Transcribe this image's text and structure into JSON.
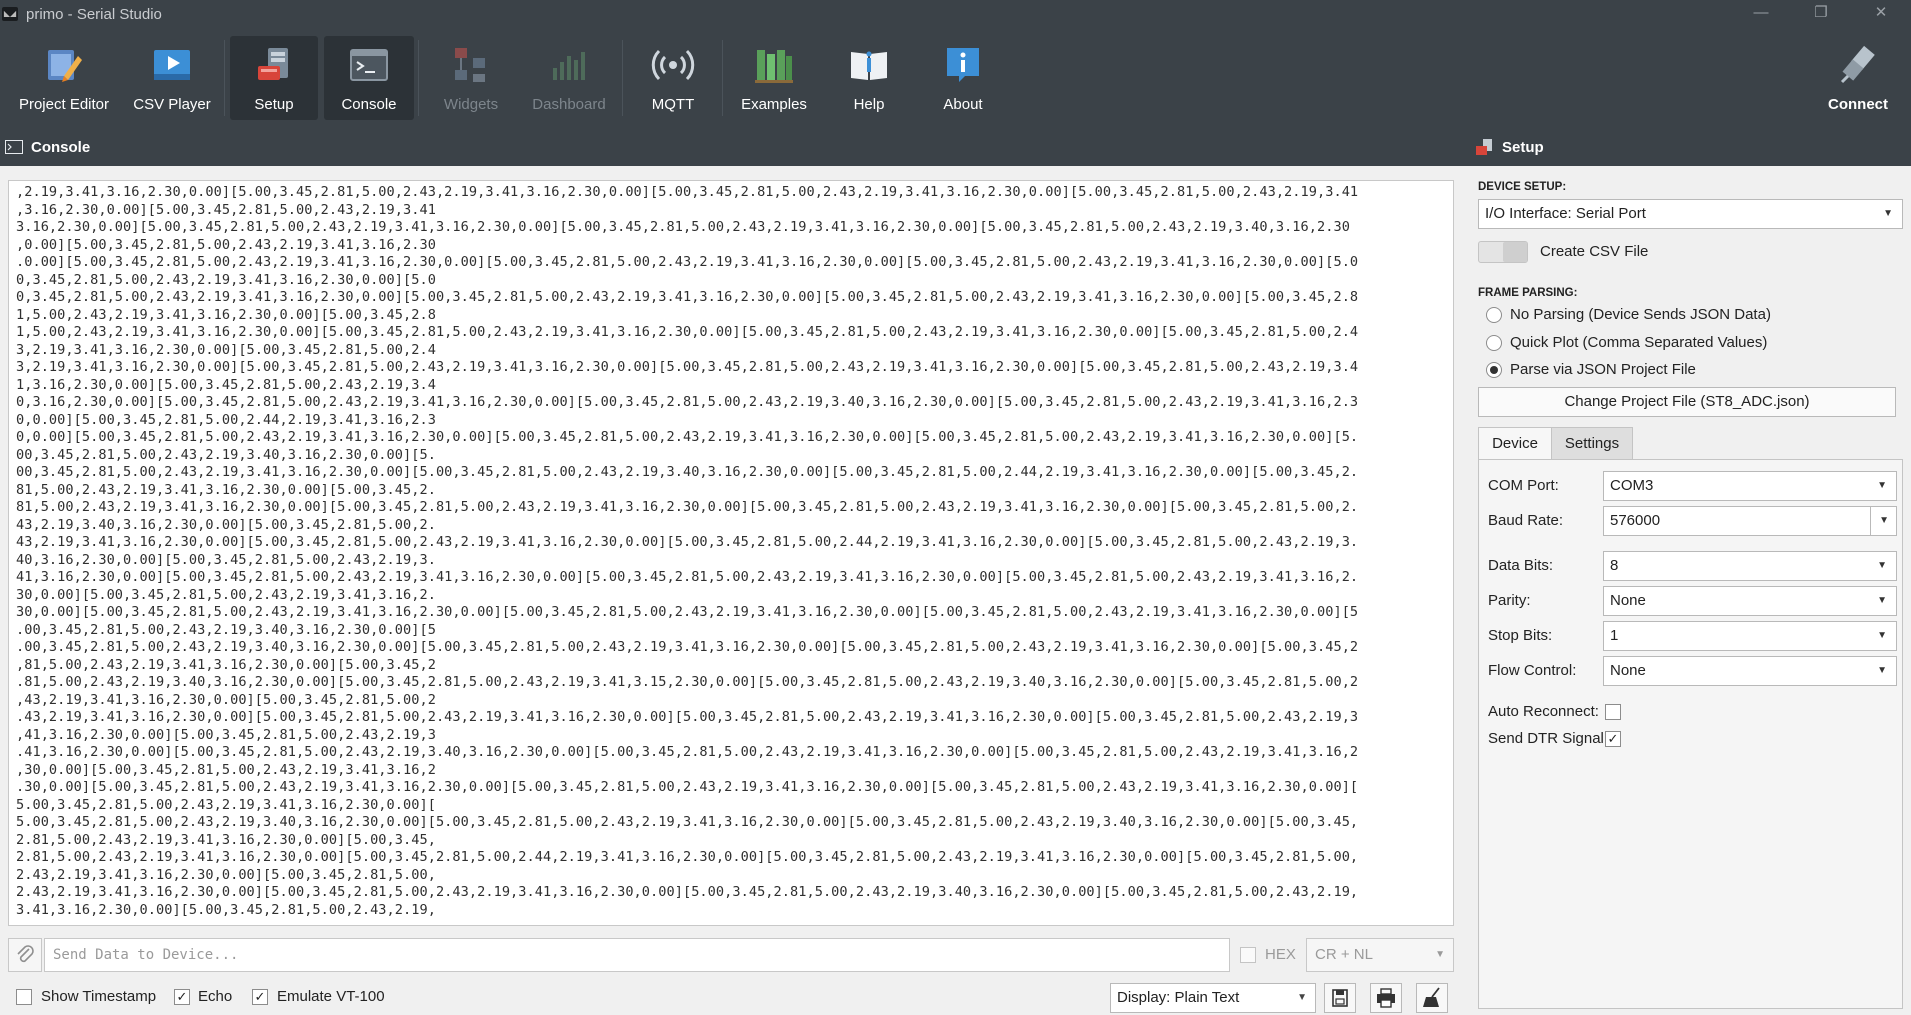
{
  "window": {
    "title": "primo - Serial Studio",
    "controls": [
      "—",
      "❐",
      "✕"
    ]
  },
  "toolbar": {
    "buttons": [
      {
        "label": "Project Editor"
      },
      {
        "label": "CSV Player"
      },
      {
        "label": "Setup"
      },
      {
        "label": "Console"
      },
      {
        "label": "Widgets"
      },
      {
        "label": "Dashboard"
      },
      {
        "label": "MQTT"
      },
      {
        "label": "Examples"
      },
      {
        "label": "Help"
      },
      {
        "label": "About"
      }
    ],
    "connect_label": "Connect"
  },
  "console": {
    "header": "Console",
    "lines": [
      ",2.19,3.41,3.16,2.30,0.00][5.00,3.45,2.81,5.00,2.43,2.19,3.41,3.16,2.30,0.00][5.00,3.45,2.81,5.00,2.43,2.19,3.41,3.16,2.30,0.00][5.00,3.45,2.81,5.00,2.43,2.19,3.41",
      ",3.16,2.30,0.00][5.00,3.45,2.81,5.00,2.43,2.19,3.41",
      "3.16,2.30,0.00][5.00,3.45,2.81,5.00,2.43,2.19,3.41,3.16,2.30,0.00][5.00,3.45,2.81,5.00,2.43,2.19,3.41,3.16,2.30,0.00][5.00,3.45,2.81,5.00,2.43,2.19,3.40,3.16,2.30",
      ",0.00][5.00,3.45,2.81,5.00,2.43,2.19,3.41,3.16,2.30",
      ".0.00][5.00,3.45,2.81,5.00,2.43,2.19,3.41,3.16,2.30,0.00][5.00,3.45,2.81,5.00,2.43,2.19,3.41,3.16,2.30,0.00][5.00,3.45,2.81,5.00,2.43,2.19,3.41,3.16,2.30,0.00][5.0",
      "0,3.45,2.81,5.00,2.43,2.19,3.41,3.16,2.30,0.00][5.0",
      "0,3.45,2.81,5.00,2.43,2.19,3.41,3.16,2.30,0.00][5.00,3.45,2.81,5.00,2.43,2.19,3.41,3.16,2.30,0.00][5.00,3.45,2.81,5.00,2.43,2.19,3.41,3.16,2.30,0.00][5.00,3.45,2.8",
      "1,5.00,2.43,2.19,3.41,3.16,2.30,0.00][5.00,3.45,2.8",
      "1,5.00,2.43,2.19,3.41,3.16,2.30,0.00][5.00,3.45,2.81,5.00,2.43,2.19,3.41,3.16,2.30,0.00][5.00,3.45,2.81,5.00,2.43,2.19,3.41,3.16,2.30,0.00][5.00,3.45,2.81,5.00,2.4",
      "3,2.19,3.41,3.16,2.30,0.00][5.00,3.45,2.81,5.00,2.4",
      "3,2.19,3.41,3.16,2.30,0.00][5.00,3.45,2.81,5.00,2.43,2.19,3.41,3.16,2.30,0.00][5.00,3.45,2.81,5.00,2.43,2.19,3.41,3.16,2.30,0.00][5.00,3.45,2.81,5.00,2.43,2.19,3.4",
      "1,3.16,2.30,0.00][5.00,3.45,2.81,5.00,2.43,2.19,3.4",
      "0,3.16,2.30,0.00][5.00,3.45,2.81,5.00,2.43,2.19,3.41,3.16,2.30,0.00][5.00,3.45,2.81,5.00,2.43,2.19,3.40,3.16,2.30,0.00][5.00,3.45,2.81,5.00,2.43,2.19,3.41,3.16,2.3",
      "0,0.00][5.00,3.45,2.81,5.00,2.44,2.19,3.41,3.16,2.3",
      "0,0.00][5.00,3.45,2.81,5.00,2.43,2.19,3.41,3.16,2.30,0.00][5.00,3.45,2.81,5.00,2.43,2.19,3.41,3.16,2.30,0.00][5.00,3.45,2.81,5.00,2.43,2.19,3.41,3.16,2.30,0.00][5.",
      "00,3.45,2.81,5.00,2.43,2.19,3.40,3.16,2.30,0.00][5.",
      "00,3.45,2.81,5.00,2.43,2.19,3.41,3.16,2.30,0.00][5.00,3.45,2.81,5.00,2.43,2.19,3.40,3.16,2.30,0.00][5.00,3.45,2.81,5.00,2.44,2.19,3.41,3.16,2.30,0.00][5.00,3.45,2.",
      "81,5.00,2.43,2.19,3.41,3.16,2.30,0.00][5.00,3.45,2.",
      "81,5.00,2.43,2.19,3.41,3.16,2.30,0.00][5.00,3.45,2.81,5.00,2.43,2.19,3.41,3.16,2.30,0.00][5.00,3.45,2.81,5.00,2.43,2.19,3.41,3.16,2.30,0.00][5.00,3.45,2.81,5.00,2.",
      "43,2.19,3.40,3.16,2.30,0.00][5.00,3.45,2.81,5.00,2.",
      "43,2.19,3.41,3.16,2.30,0.00][5.00,3.45,2.81,5.00,2.43,2.19,3.41,3.16,2.30,0.00][5.00,3.45,2.81,5.00,2.44,2.19,3.41,3.16,2.30,0.00][5.00,3.45,2.81,5.00,2.43,2.19,3.",
      "40,3.16,2.30,0.00][5.00,3.45,2.81,5.00,2.43,2.19,3.",
      "41,3.16,2.30,0.00][5.00,3.45,2.81,5.00,2.43,2.19,3.41,3.16,2.30,0.00][5.00,3.45,2.81,5.00,2.43,2.19,3.41,3.16,2.30,0.00][5.00,3.45,2.81,5.00,2.43,2.19,3.41,3.16,2.",
      "30,0.00][5.00,3.45,2.81,5.00,2.43,2.19,3.41,3.16,2.",
      "30,0.00][5.00,3.45,2.81,5.00,2.43,2.19,3.41,3.16,2.30,0.00][5.00,3.45,2.81,5.00,2.43,2.19,3.41,3.16,2.30,0.00][5.00,3.45,2.81,5.00,2.43,2.19,3.41,3.16,2.30,0.00][5",
      ".00,3.45,2.81,5.00,2.43,2.19,3.40,3.16,2.30,0.00][5",
      ".00,3.45,2.81,5.00,2.43,2.19,3.40,3.16,2.30,0.00][5.00,3.45,2.81,5.00,2.43,2.19,3.41,3.16,2.30,0.00][5.00,3.45,2.81,5.00,2.43,2.19,3.41,3.16,2.30,0.00][5.00,3.45,2",
      ",81,5.00,2.43,2.19,3.41,3.16,2.30,0.00][5.00,3.45,2",
      ".81,5.00,2.43,2.19,3.40,3.16,2.30,0.00][5.00,3.45,2.81,5.00,2.43,2.19,3.41,3.15,2.30,0.00][5.00,3.45,2.81,5.00,2.43,2.19,3.40,3.16,2.30,0.00][5.00,3.45,2.81,5.00,2",
      ",43,2.19,3.41,3.16,2.30,0.00][5.00,3.45,2.81,5.00,2",
      ".43,2.19,3.41,3.16,2.30,0.00][5.00,3.45,2.81,5.00,2.43,2.19,3.41,3.16,2.30,0.00][5.00,3.45,2.81,5.00,2.43,2.19,3.41,3.16,2.30,0.00][5.00,3.45,2.81,5.00,2.43,2.19,3",
      ",41,3.16,2.30,0.00][5.00,3.45,2.81,5.00,2.43,2.19,3",
      ".41,3.16,2.30,0.00][5.00,3.45,2.81,5.00,2.43,2.19,3.40,3.16,2.30,0.00][5.00,3.45,2.81,5.00,2.43,2.19,3.41,3.16,2.30,0.00][5.00,3.45,2.81,5.00,2.43,2.19,3.41,3.16,2",
      ",30,0.00][5.00,3.45,2.81,5.00,2.43,2.19,3.41,3.16,2",
      ".30,0.00][5.00,3.45,2.81,5.00,2.43,2.19,3.41,3.16,2.30,0.00][5.00,3.45,2.81,5.00,2.43,2.19,3.41,3.16,2.30,0.00][5.00,3.45,2.81,5.00,2.43,2.19,3.41,3.16,2.30,0.00][",
      "5.00,3.45,2.81,5.00,2.43,2.19,3.41,3.16,2.30,0.00][",
      "5.00,3.45,2.81,5.00,2.43,2.19,3.40,3.16,2.30,0.00][5.00,3.45,2.81,5.00,2.43,2.19,3.41,3.16,2.30,0.00][5.00,3.45,2.81,5.00,2.43,2.19,3.40,3.16,2.30,0.00][5.00,3.45,",
      "2.81,5.00,2.43,2.19,3.41,3.16,2.30,0.00][5.00,3.45,",
      "2.81,5.00,2.43,2.19,3.41,3.16,2.30,0.00][5.00,3.45,2.81,5.00,2.44,2.19,3.41,3.16,2.30,0.00][5.00,3.45,2.81,5.00,2.43,2.19,3.41,3.16,2.30,0.00][5.00,3.45,2.81,5.00,",
      "2.43,2.19,3.41,3.16,2.30,0.00][5.00,3.45,2.81,5.00,",
      "2.43,2.19,3.41,3.16,2.30,0.00][5.00,3.45,2.81,5.00,2.43,2.19,3.41,3.16,2.30,0.00][5.00,3.45,2.81,5.00,2.43,2.19,3.40,3.16,2.30,0.00][5.00,3.45,2.81,5.00,2.43,2.19,",
      "3.41,3.16,2.30,0.00][5.00,3.45,2.81,5.00,2.43,2.19,"
    ],
    "send_placeholder": "Send Data to Device...",
    "hex_label": "HEX",
    "line_ending": "CR + NL",
    "show_timestamp_label": "Show Timestamp",
    "show_timestamp_checked": "",
    "echo_label": "Echo",
    "echo_checked": "✓",
    "vt100_label": "Emulate VT-100",
    "vt100_checked": "✓",
    "display_mode": "Display: Plain Text"
  },
  "setup": {
    "header": "Setup",
    "device_setup_title": "DEVICE SETUP:",
    "io_interface": "I/O Interface: Serial Port",
    "create_csv_label": "Create CSV File",
    "frame_parsing_title": "FRAME PARSING:",
    "parsing_options": [
      {
        "label": "No Parsing (Device Sends JSON Data)",
        "selected": false
      },
      {
        "label": "Quick Plot (Comma Separated Values)",
        "selected": false
      },
      {
        "label": "Parse via JSON Project File",
        "selected": true
      }
    ],
    "change_project_label": "Change Project File (ST8_ADC.json)",
    "tabs": [
      {
        "label": "Device"
      },
      {
        "label": "Settings"
      }
    ],
    "fields": {
      "com_port_label": "COM Port:",
      "com_port_value": "COM3",
      "baud_label": "Baud Rate:",
      "baud_value": "576000",
      "data_bits_label": "Data Bits:",
      "data_bits_value": "8",
      "parity_label": "Parity:",
      "parity_value": "None",
      "stop_bits_label": "Stop Bits:",
      "stop_bits_value": "1",
      "flow_label": "Flow Control:",
      "flow_value": "None",
      "auto_reconnect_label": "Auto Reconnect:",
      "auto_reconnect_checked": "",
      "dtr_label": "Send DTR Signal:",
      "dtr_checked": "✓"
    }
  },
  "colors": {
    "toolbar_bg": "#3b4248",
    "accent_blue": "#3c8fd6",
    "setup_icon_red": "#d8453a"
  }
}
